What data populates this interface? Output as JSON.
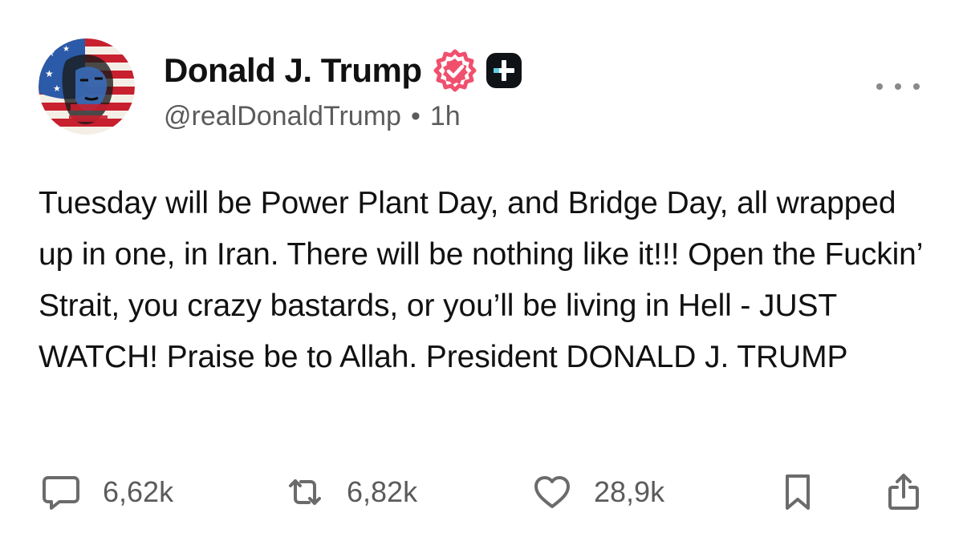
{
  "author": {
    "display_name": "Donald J. Trump",
    "handle": "@realDonaldTrump",
    "separator": "•",
    "time": "1h",
    "verified_badge_icon": "verified-badge-icon",
    "verified_color": "#f0506e",
    "plus_badge_icon": "plus-badge-icon"
  },
  "post": {
    "text": "Tuesday will be Power Plant Day, and Bridge Day, all wrapped up in one, in Iran. There will be nothing like it!!! Open the Fuckin’ Strait, you crazy bastards, or you’ll be living in Hell - JUST WATCH! Praise be to Allah. President DONALD J. TRUMP"
  },
  "actions": {
    "replies": "6,62k",
    "reposts": "6,82k",
    "likes": "28,9k",
    "icons": [
      "reply-icon",
      "repost-icon",
      "heart-icon",
      "bookmark-icon",
      "share-icon"
    ]
  },
  "colors": {
    "text": "#111111",
    "secondary": "#5b5b5b",
    "icon": "#6b6b6b"
  }
}
